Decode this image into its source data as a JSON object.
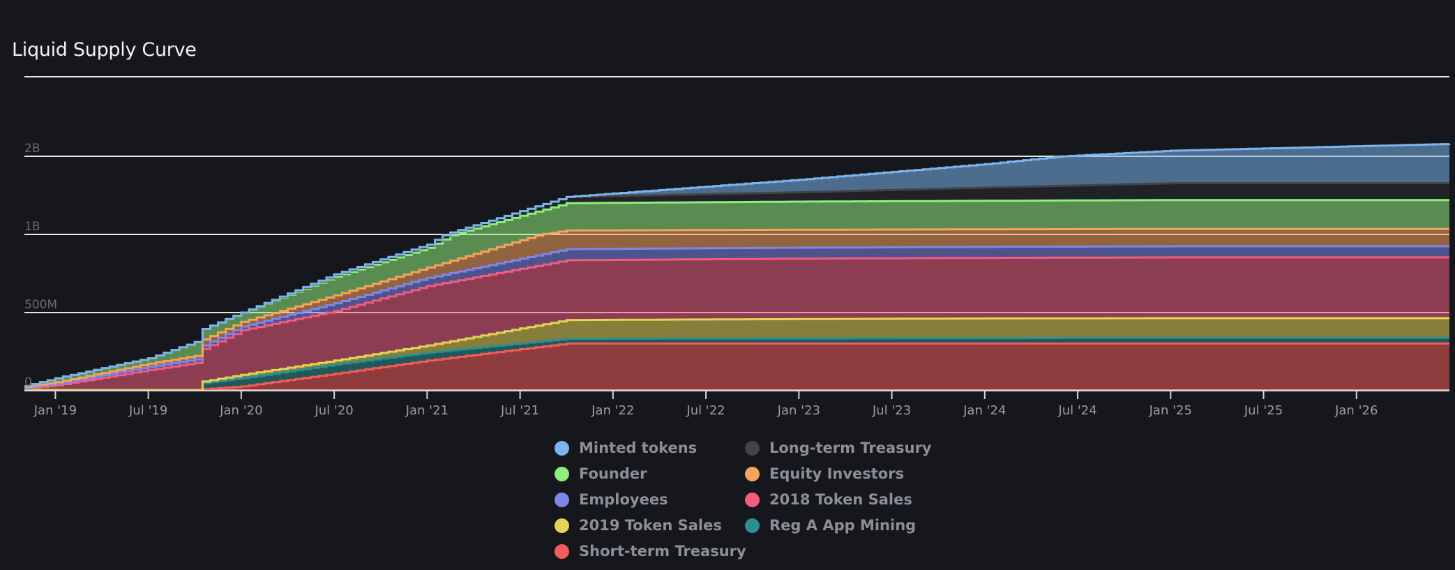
{
  "chart_data": {
    "type": "area",
    "stacked": true,
    "title": "Liquid Supply Curve",
    "xlabel": "",
    "ylabel": "",
    "x_unit": "months since Jan 2019",
    "xlim": [
      -2,
      90
    ],
    "x_ticks": [
      {
        "month": 0,
        "label": "Jan '19"
      },
      {
        "month": 6,
        "label": "Jul '19"
      },
      {
        "month": 12,
        "label": "Jan '20"
      },
      {
        "month": 18,
        "label": "Jul '20"
      },
      {
        "month": 24,
        "label": "Jan '21"
      },
      {
        "month": 30,
        "label": "Jul '21"
      },
      {
        "month": 36,
        "label": "Jan '22"
      },
      {
        "month": 42,
        "label": "Jul '22"
      },
      {
        "month": 48,
        "label": "Jan '23"
      },
      {
        "month": 54,
        "label": "Jul '23"
      },
      {
        "month": 60,
        "label": "Jan '24"
      },
      {
        "month": 66,
        "label": "Jul '24"
      },
      {
        "month": 72,
        "label": "Jan '25"
      },
      {
        "month": 78,
        "label": "Jul '25"
      },
      {
        "month": 84,
        "label": "Jan '26"
      }
    ],
    "y_unit": "millions of tokens (cumulative stacked top)",
    "y_ticks": [
      {
        "value": 0,
        "label": "0"
      },
      {
        "value": 500,
        "label": "500M"
      },
      {
        "value": 1000,
        "label": "1B"
      },
      {
        "value": 2000,
        "label": "2B"
      },
      {
        "value": 4000,
        "label": ""
      }
    ],
    "grid": true,
    "legend_position": "bottom-center",
    "x": [
      -2,
      0,
      6,
      9,
      9.5,
      12,
      18,
      24,
      33,
      48,
      60,
      72,
      90
    ],
    "series": [
      {
        "name": "Short-term Treasury",
        "color": "#f45b5b",
        "values": [
          0,
          0,
          0,
          0,
          5,
          23,
          105,
          190,
          300,
          300,
          300,
          300,
          300
        ]
      },
      {
        "name": "Reg A App Mining",
        "color": "#2b908f",
        "values": [
          0,
          0,
          0,
          0,
          45,
          76,
          165,
          242,
          331,
          333,
          335,
          337,
          337
        ]
      },
      {
        "name": "2019 Token Sales",
        "color": "#e4d354",
        "values": [
          0,
          0,
          0,
          0,
          55,
          98,
          190,
          288,
          452,
          458,
          462,
          464,
          464
        ]
      },
      {
        "name": "2018 Token Sales",
        "color": "#f15c80",
        "values": [
          10,
          30,
          129,
          174,
          265,
          386,
          510,
          670,
          835,
          845,
          850,
          853,
          853
        ]
      },
      {
        "name": "Employees",
        "color": "#8085e9",
        "values": [
          15,
          40,
          150,
          197,
          288,
          410,
          560,
          722,
          906,
          915,
          920,
          924,
          924
        ]
      },
      {
        "name": "Equity Investors",
        "color": "#f7a35c",
        "values": [
          20,
          50,
          170,
          220,
          326,
          440,
          610,
          788,
          1050,
          1060,
          1065,
          1070,
          1070
        ]
      },
      {
        "name": "Founder",
        "color": "#90ed7d",
        "values": [
          25,
          76,
          205,
          310,
          394,
          500,
          730,
          914,
          1400,
          1420,
          1430,
          1440,
          1440
        ]
      },
      {
        "name": "Long-term Treasury",
        "color": "#434348",
        "values": [
          25,
          76,
          205,
          310,
          394,
          500,
          740,
          930,
          1480,
          1540,
          1600,
          1655,
          1655
        ]
      },
      {
        "name": "Minted tokens",
        "color": "#7cb5ec",
        "values": [
          25,
          76,
          205,
          310,
          394,
          500,
          745,
          935,
          1480,
          1700,
          1900,
          2140,
          2310
        ]
      }
    ]
  },
  "legend": [
    {
      "name": "Minted tokens",
      "color": "#7cb5ec"
    },
    {
      "name": "Long-term Treasury",
      "color": "#434348"
    },
    {
      "name": "Founder",
      "color": "#90ed7d"
    },
    {
      "name": "Equity Investors",
      "color": "#f7a35c"
    },
    {
      "name": "Employees",
      "color": "#8085e9"
    },
    {
      "name": "2018 Token Sales",
      "color": "#f15c80"
    },
    {
      "name": "2019 Token Sales",
      "color": "#e4d354"
    },
    {
      "name": "Reg A App Mining",
      "color": "#2b908f"
    },
    {
      "name": "Short-term Treasury",
      "color": "#f45b5b"
    }
  ]
}
